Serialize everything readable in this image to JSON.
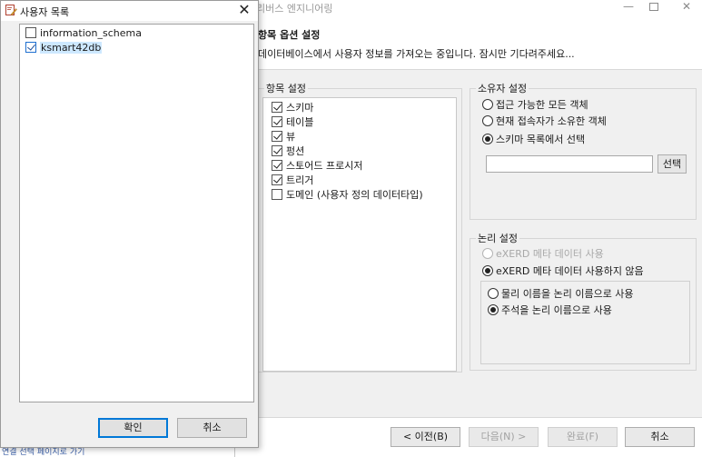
{
  "wizard": {
    "title": "리버스 엔지니어링",
    "section_title": "항목 옵션 설정",
    "section_desc": "데이터베이스에서 사용자 정보를 가져오는 중입니다. 잠시만 기다려주세요...",
    "item_group_title": "항목 설정",
    "items": [
      {
        "label": "스키마",
        "checked": true
      },
      {
        "label": "테이블",
        "checked": true
      },
      {
        "label": "뷰",
        "checked": true
      },
      {
        "label": "펑션",
        "checked": true
      },
      {
        "label": "스토어드 프로시저",
        "checked": true
      },
      {
        "label": "트리거",
        "checked": true
      },
      {
        "label": "도메인 (사용자 정의 데이터타입)",
        "checked": false
      }
    ],
    "owner_group_title": "소유자 설정",
    "owner_options": [
      {
        "label": "접근 가능한 모든 객체",
        "selected": false
      },
      {
        "label": "현재 접속자가 소유한 객체",
        "selected": false
      },
      {
        "label": "스키마 목록에서 선택",
        "selected": true
      }
    ],
    "owner_input_value": "",
    "owner_select_button": "선택",
    "logic_group_title": "논리 설정",
    "logic_options": [
      {
        "label": "eXERD 메타 데이터 사용",
        "selected": false,
        "disabled": true
      },
      {
        "label": "eXERD 메타 데이터 사용하지 않음",
        "selected": true,
        "disabled": false
      }
    ],
    "name_options": [
      {
        "label": "물리 이름을 논리 이름으로 사용",
        "selected": false
      },
      {
        "label": "주석을 논리 이름으로 사용",
        "selected": true
      }
    ],
    "buttons": {
      "back": "< 이전(B)",
      "next": "다음(N) >",
      "finish": "완료(F)",
      "cancel": "취소"
    }
  },
  "dialog": {
    "title": "사용자 목록",
    "users": [
      {
        "label": "information_schema",
        "checked": false,
        "selected": false
      },
      {
        "label": "ksmart42db",
        "checked": true,
        "selected": true
      }
    ],
    "ok": "확인",
    "cancel": "취소"
  },
  "background_peek_text": "연결 선택 페이지로 가기"
}
